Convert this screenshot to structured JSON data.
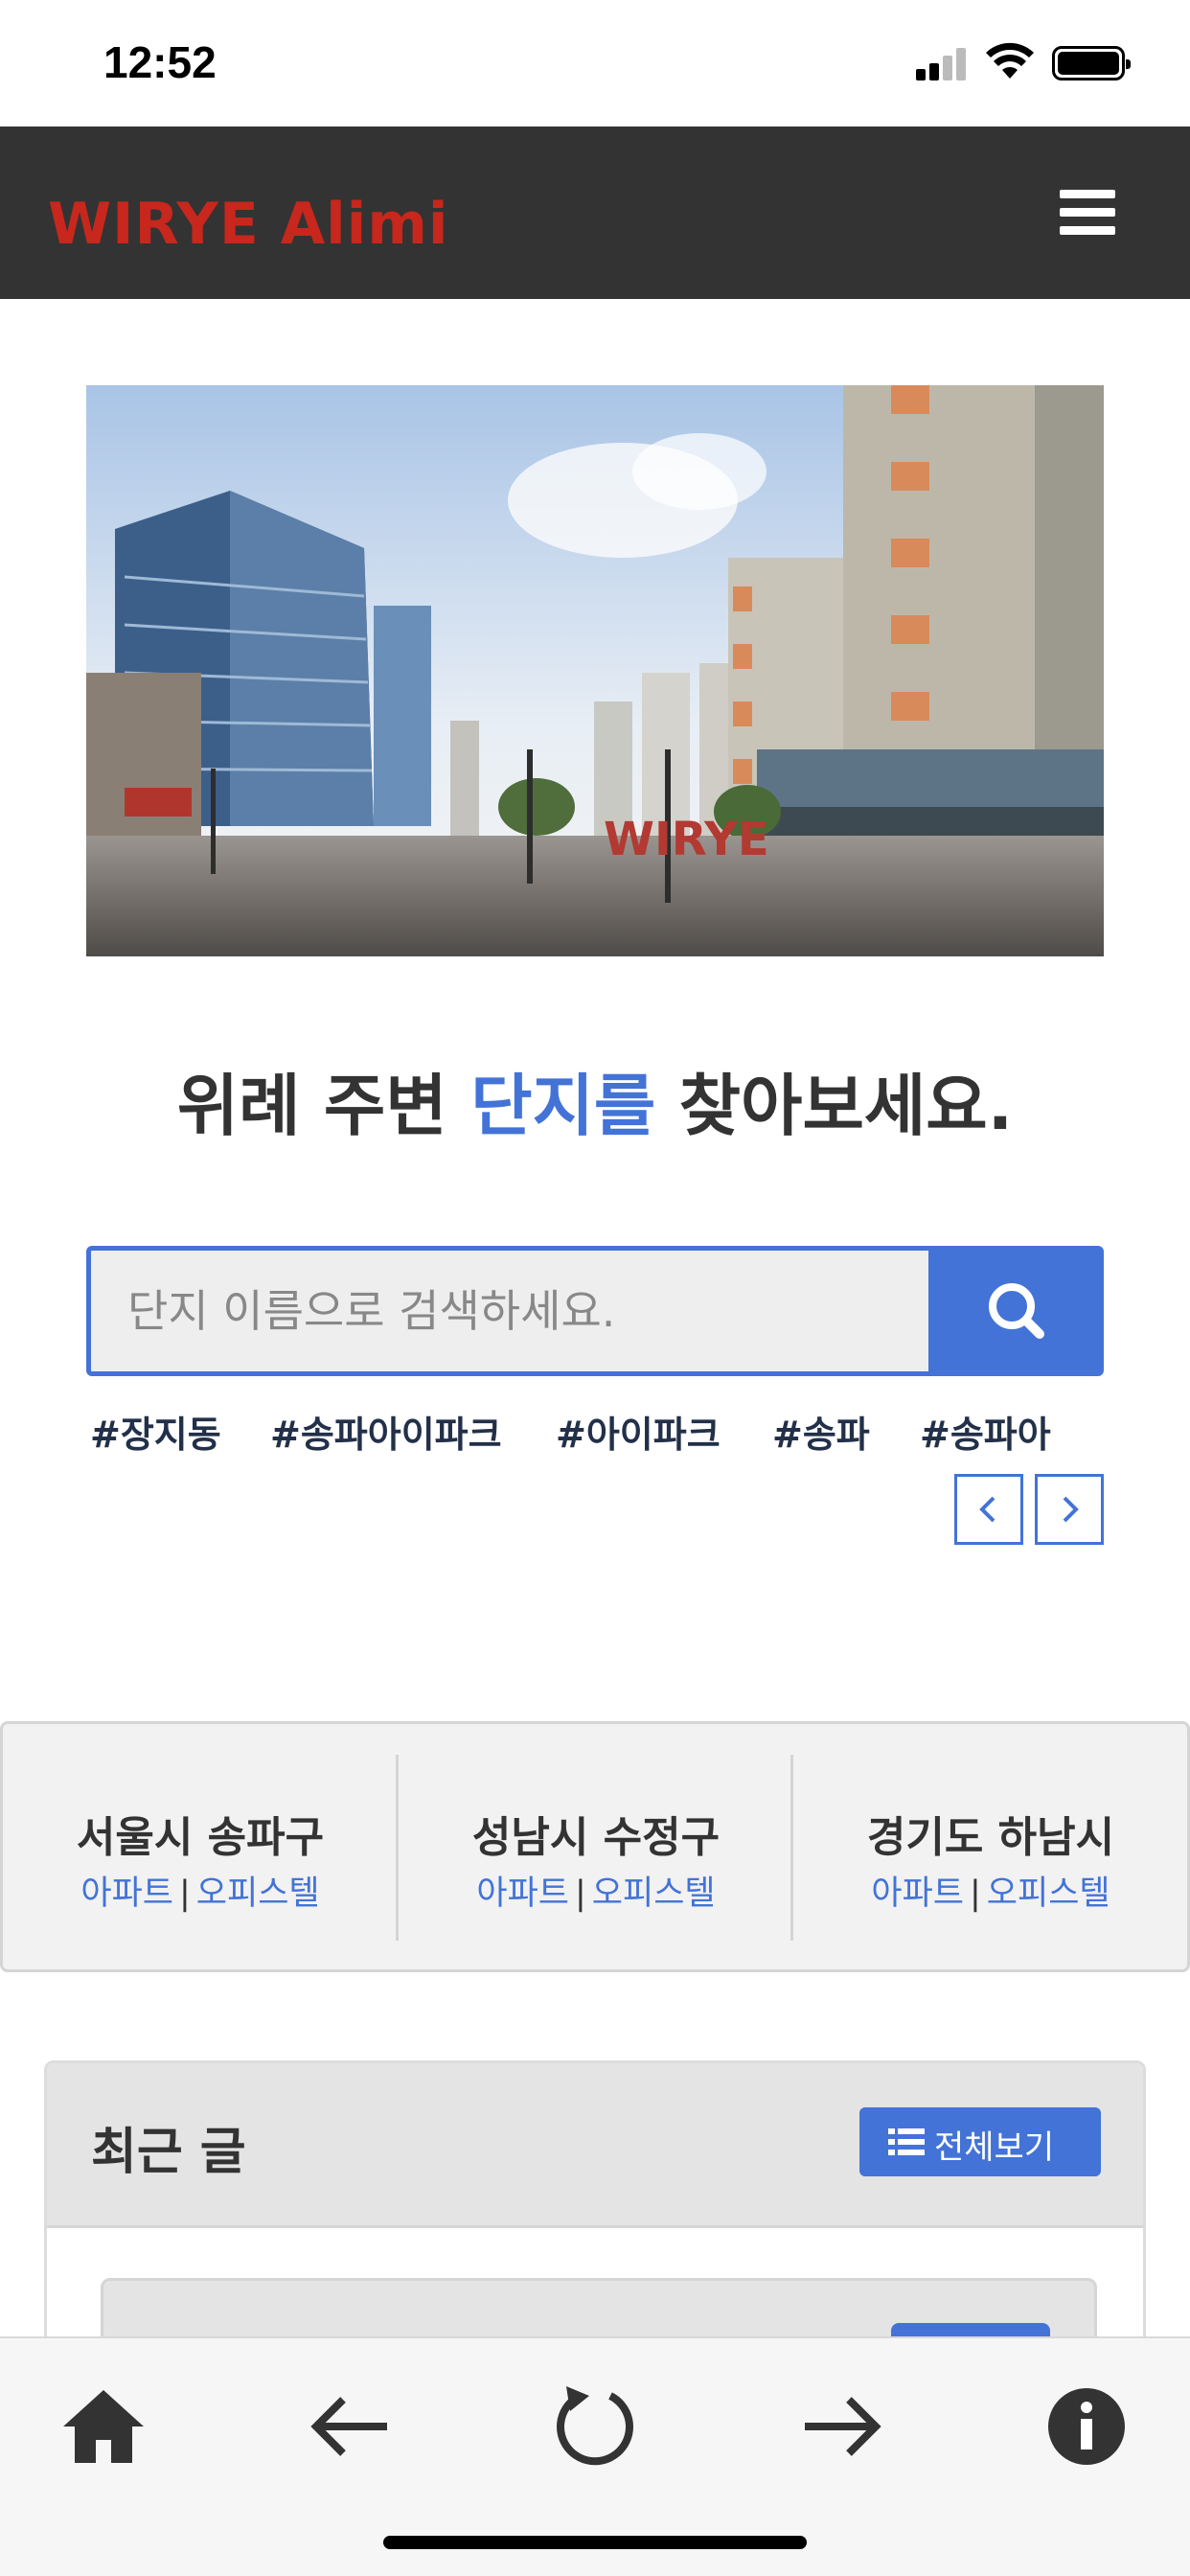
{
  "status_bar": {
    "time": "12:52"
  },
  "header": {
    "brand": "WIRYE Alimi",
    "menu_icon": "hamburger-menu-icon"
  },
  "hero": {
    "description_icon": "city-plaza-photo",
    "sign_text": "WIRYE"
  },
  "headline": {
    "prefix": "위례 주변 ",
    "accent": "단지를",
    "suffix": " 찾아보세요."
  },
  "search": {
    "placeholder": "단지 이름으로 검색하세요.",
    "button_icon": "search-icon"
  },
  "tags": [
    "#장지동",
    "#송파아이파크",
    "#아이파크",
    "#송파",
    "#송파아"
  ],
  "tag_nav": {
    "prev_icon": "chevron-left-icon",
    "next_icon": "chevron-right-icon"
  },
  "regions": [
    {
      "name": "서울시 송파구",
      "apt": "아파트",
      "sep": "|",
      "office": "오피스텔"
    },
    {
      "name": "성남시 수정구",
      "apt": "아파트",
      "sep": "|",
      "office": "오피스텔"
    },
    {
      "name": "경기도 하남시",
      "apt": "아파트",
      "sep": "|",
      "office": "오피스텔"
    }
  ],
  "recent": {
    "title": "최근 글",
    "view_all": "전체보기"
  },
  "toolbar": {
    "home_icon": "home-icon",
    "back_icon": "arrow-left-icon",
    "reload_icon": "reload-icon",
    "forward_icon": "arrow-right-icon",
    "info_icon": "info-icon"
  },
  "colors": {
    "accent": "#4373d7",
    "header_bg": "#333333",
    "brand": "#c7271c"
  }
}
